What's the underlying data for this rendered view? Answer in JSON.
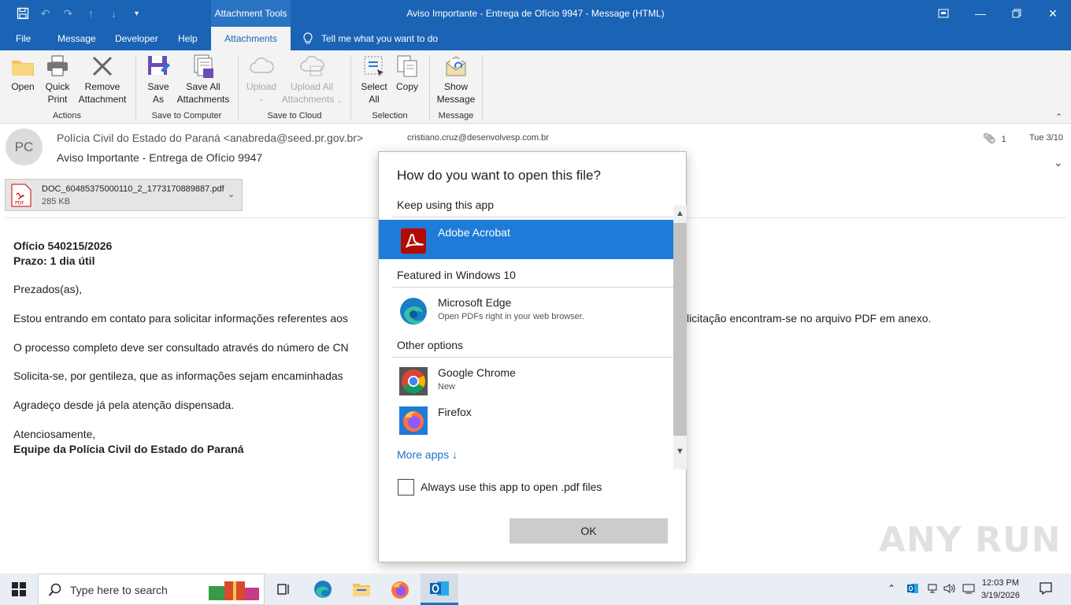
{
  "window": {
    "title": "Aviso Importante - Entrega de Ofício 9947  -  Message (HTML)",
    "context_tab": "Attachment Tools"
  },
  "menu": {
    "tabs": [
      "File",
      "Message",
      "Developer",
      "Help",
      "Attachments"
    ],
    "active_tab": "Attachments",
    "tell_me": "Tell me what you want to do"
  },
  "ribbon": {
    "buttons": {
      "open": "Open",
      "quick_print_1": "Quick",
      "quick_print_2": "Print",
      "remove_1": "Remove",
      "remove_2": "Attachment",
      "save_as_1": "Save",
      "save_as_2": "As",
      "save_all_1": "Save All",
      "save_all_2": "Attachments",
      "upload": "Upload",
      "upload_all_1": "Upload All",
      "upload_all_2": "Attachments",
      "select_all_1": "Select",
      "select_all_2": "All",
      "copy": "Copy",
      "show_message_1": "Show",
      "show_message_2": "Message"
    },
    "groups": {
      "actions": "Actions",
      "save_computer": "Save to Computer",
      "save_cloud": "Save to Cloud",
      "selection": "Selection",
      "message": "Message"
    }
  },
  "header": {
    "avatar_initials": "PC",
    "sender": "Polícia Civil do Estado do Paraná <anabreda@seed.pr.gov.br>",
    "subject": "Aviso Importante - Entrega de Ofício 9947",
    "to": "cristiano.cruz@desenvolvesp.com.br",
    "attachment_count": "1",
    "date": "Tue 3/10"
  },
  "attachment": {
    "name": "DOC_60485375000110_2_1773170889887.pdf",
    "size": "285 KB"
  },
  "body": {
    "line1": "Ofício 540215/2026",
    "line2": "Prazo: 1 dia útil",
    "greeting": "Prezados(as),",
    "p1a": "Estou entrando em contato para solicitar informações referentes aos",
    "p1b": "licitação encontram-se no arquivo PDF em anexo.",
    "p2": "O processo completo deve ser consultado através do número de CN",
    "p3": "Solicita-se, por gentileza, que as informações sejam encaminhadas",
    "p4": "Agradeço desde já pela atenção dispensada.",
    "closing": "Atenciosamente,",
    "signature": "Equipe da Polícia Civil do Estado do Paraná"
  },
  "dialog": {
    "title": "How do you want to open this file?",
    "section_keep": "Keep using this app",
    "section_featured": "Featured in Windows 10",
    "section_other": "Other options",
    "apps": {
      "acrobat": {
        "name": "Adobe Acrobat"
      },
      "edge": {
        "name": "Microsoft Edge",
        "sub": "Open PDFs right in your web browser."
      },
      "chrome": {
        "name": "Google Chrome",
        "sub": "New"
      },
      "firefox": {
        "name": "Firefox"
      }
    },
    "more_apps": "More apps ↓",
    "always_use": "Always use this app to open .pdf files",
    "ok": "OK"
  },
  "watermark": "ANY RUN",
  "taskbar": {
    "search_placeholder": "Type here to search",
    "time": "12:03 PM",
    "date": "3/19/2026"
  },
  "colors": {
    "titlebar": "#1a63b5",
    "selected_app": "#1f7bd8",
    "link": "#1a73c9"
  }
}
